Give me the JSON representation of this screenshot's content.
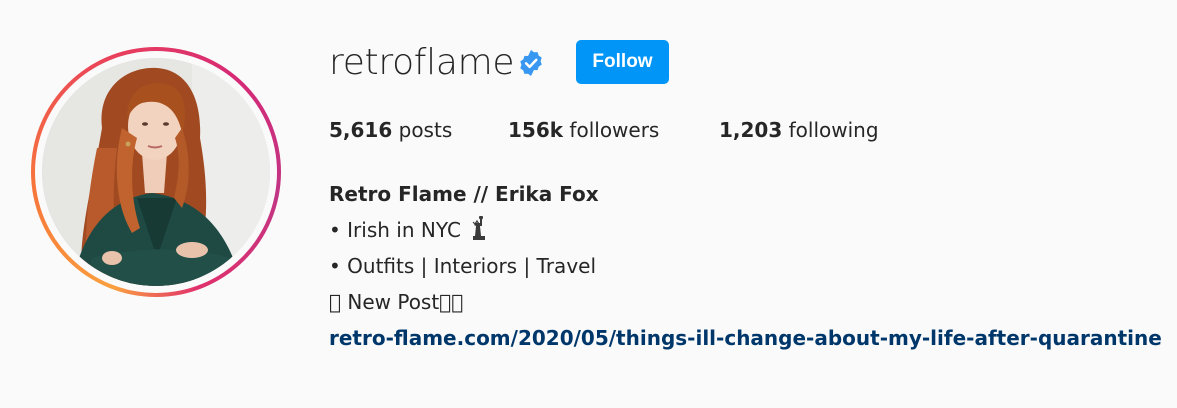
{
  "profile": {
    "username": "retroflame",
    "verified": true,
    "follow_label": "Follow",
    "stats": {
      "posts_count": "5,616",
      "posts_label": "posts",
      "followers_count": "156k",
      "followers_label": "followers",
      "following_count": "1,203",
      "following_label": "following"
    },
    "bio": {
      "full_name": "Retro Flame // Erika Fox",
      "line1": "• Irish in NYC",
      "line1_icon": "statue-of-liberty-icon",
      "line2": "• Outfits | Interiors | Travel",
      "line3": "􀀀 New Post􀀀􀀀",
      "link": "retro-flame.com/2020/05/things-ill-change-about-my-life-after-quarantine"
    }
  },
  "colors": {
    "follow_button": "#0095f6",
    "verified_badge": "#3897f0",
    "link": "#00376b",
    "text": "#262626",
    "background": "#fafafa"
  }
}
